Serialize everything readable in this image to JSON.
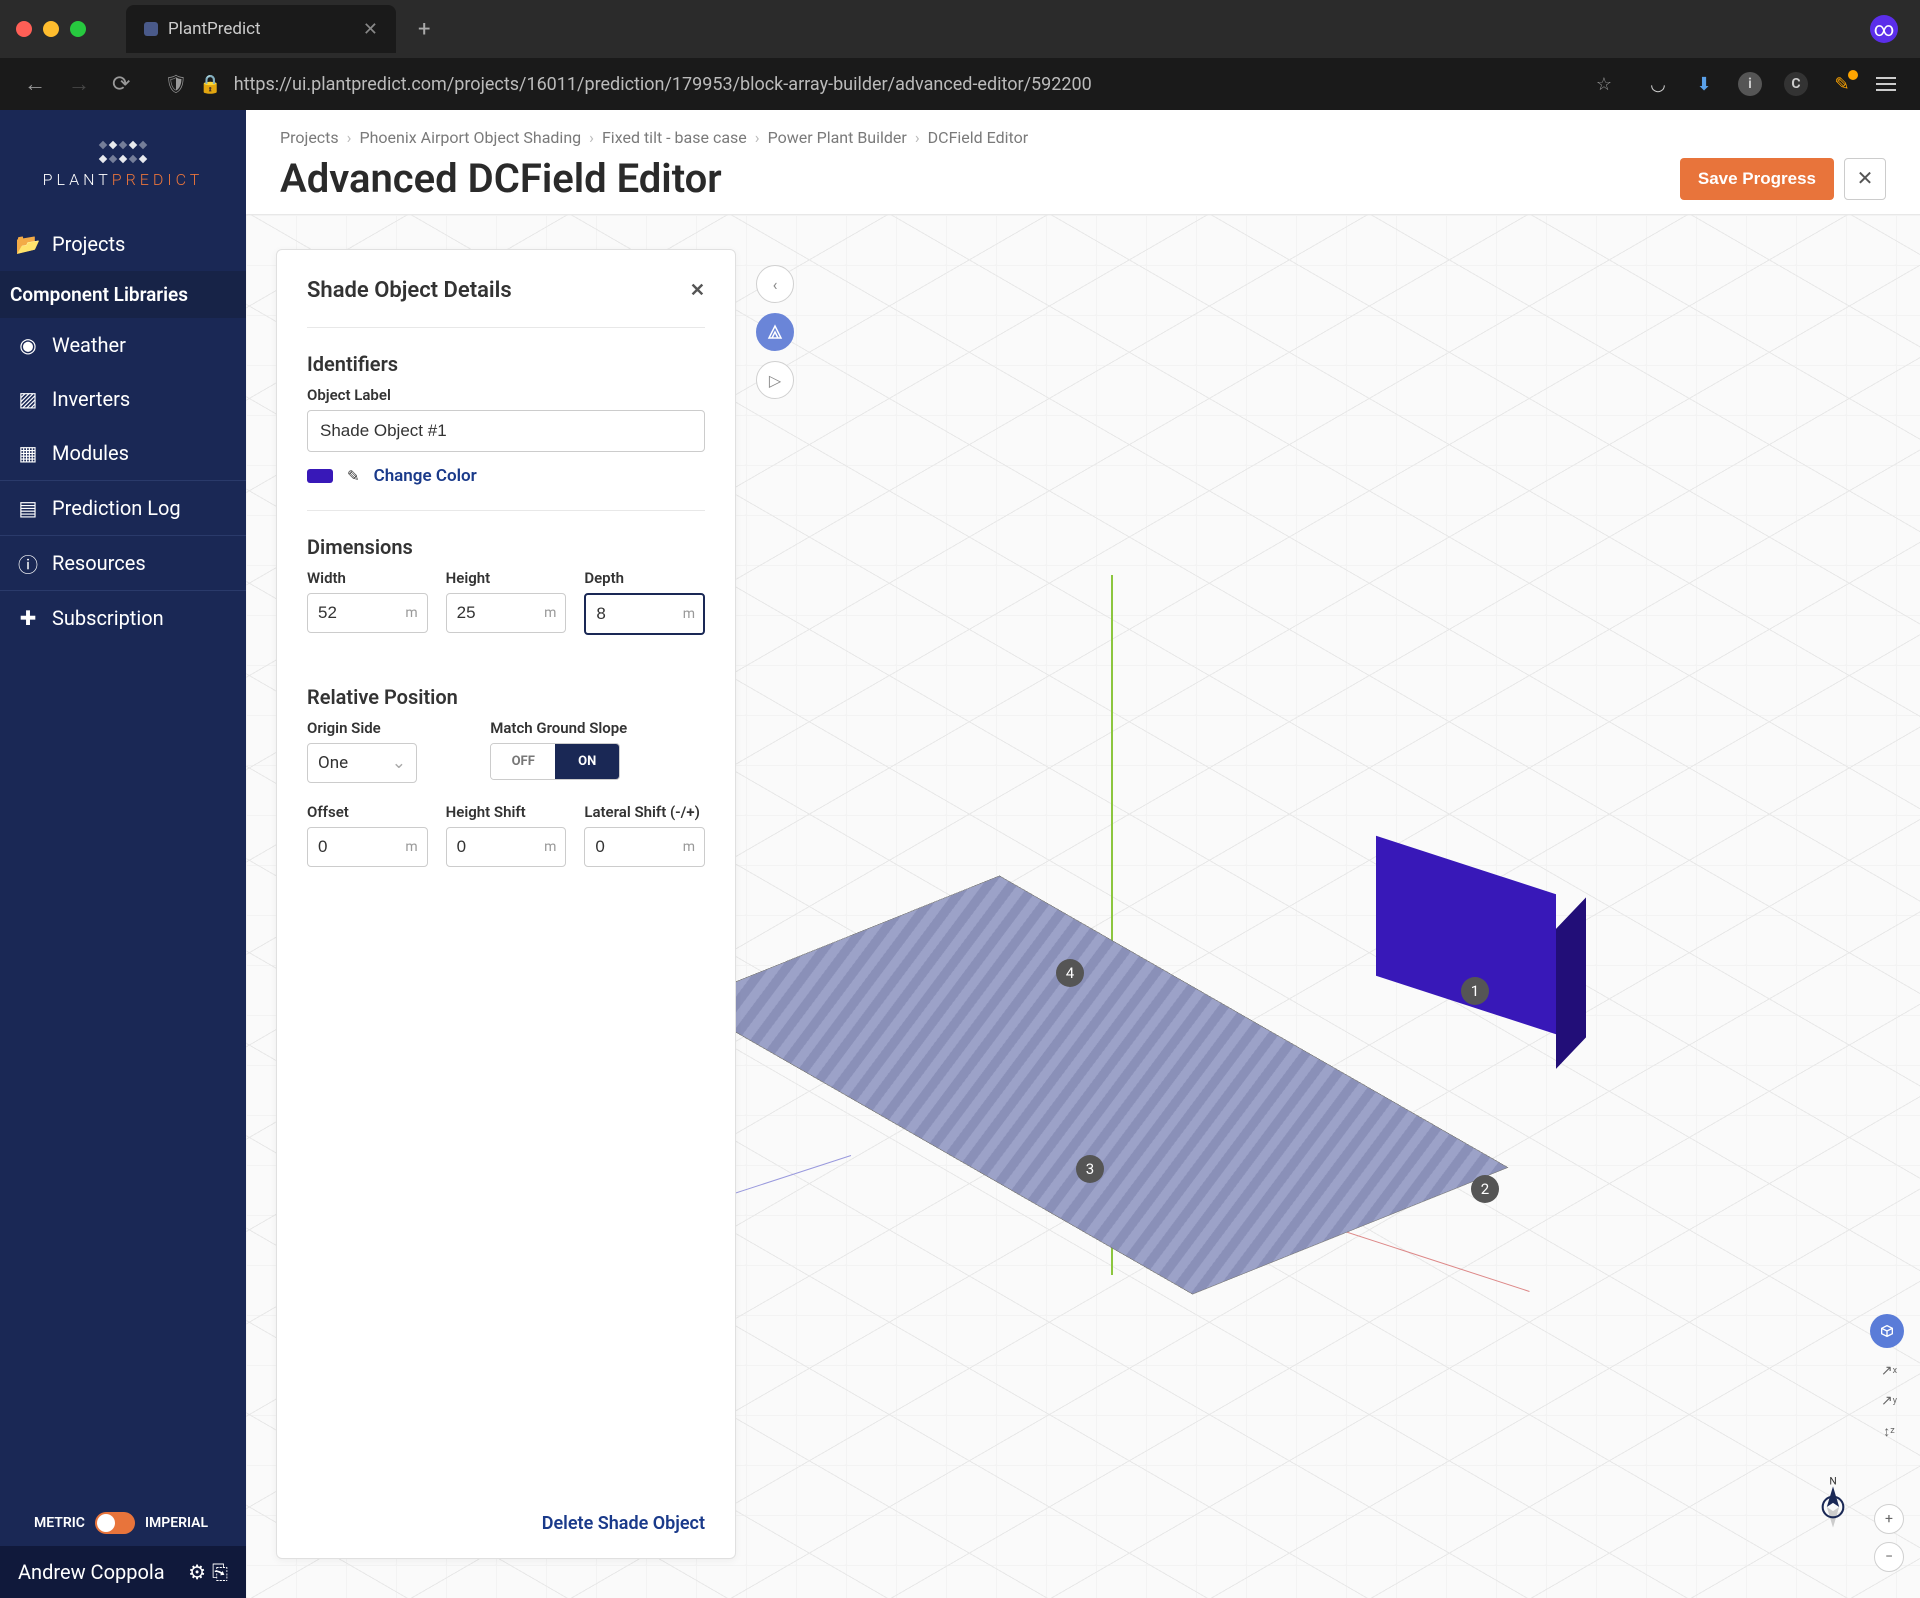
{
  "browser": {
    "tab_title": "PlantPredict",
    "url_display": "https://ui.plantpredict.com/projects/16011/prediction/179953/block-array-builder/advanced-editor/592200"
  },
  "sidebar": {
    "logo_text_1": "PLANT",
    "logo_text_2": "PREDICT",
    "items": {
      "projects": "Projects",
      "libraries_header": "Component Libraries",
      "weather": "Weather",
      "inverters": "Inverters",
      "modules": "Modules",
      "prediction_log": "Prediction Log",
      "resources": "Resources",
      "subscription": "Subscription"
    },
    "units": {
      "metric": "METRIC",
      "imperial": "IMPERIAL"
    },
    "user": "Andrew Coppola"
  },
  "breadcrumbs": [
    "Projects",
    "Phoenix Airport Object Shading",
    "Fixed tilt - base case",
    "Power Plant Builder",
    "DCField Editor"
  ],
  "page_title": "Advanced DCField Editor",
  "actions": {
    "save": "Save Progress"
  },
  "panel": {
    "title": "Shade Object Details",
    "identifiers_header": "Identifiers",
    "object_label_label": "Object Label",
    "object_label_value": "Shade Object #1",
    "change_color": "Change Color",
    "color_hex": "#3818b8",
    "dimensions_header": "Dimensions",
    "width_label": "Width",
    "width_value": "52",
    "height_label": "Height",
    "height_value": "25",
    "depth_label": "Depth",
    "depth_value": "8",
    "unit": "m",
    "rel_header": "Relative Position",
    "origin_label": "Origin Side",
    "origin_value": "One",
    "slope_label": "Match Ground Slope",
    "off": "OFF",
    "on": "ON",
    "offset_label": "Offset",
    "offset_value": "0",
    "hs_label": "Height Shift",
    "hs_value": "0",
    "ls_label": "Lateral Shift (-/+)",
    "ls_value": "0",
    "delete": "Delete Shade Object"
  },
  "scene": {
    "badges": {
      "b1": "1",
      "b2": "2",
      "b3": "3",
      "b4": "4"
    }
  }
}
